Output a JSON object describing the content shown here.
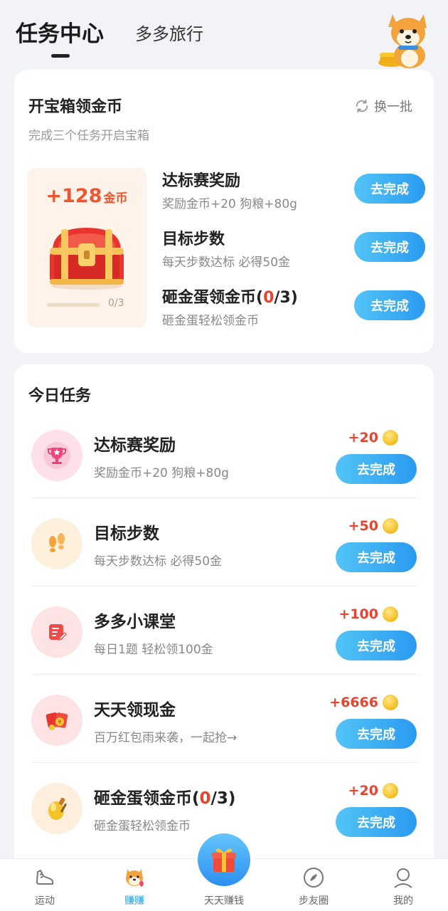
{
  "header": {
    "tab_active": "任务中心",
    "tab_inactive": "多多旅行",
    "mascot_icon": "shiba-dog-mascot"
  },
  "treasure": {
    "title": "开宝箱领金币",
    "subtitle": "完成三个任务开启宝箱",
    "refresh_label": "换一批",
    "amount": "+128",
    "amount_unit": "金币",
    "progress_label": "0/3",
    "progress_fraction": 0,
    "tasks": [
      {
        "title": "达标赛奖励",
        "desc": "奖励金币+20  狗粮+80g",
        "button": "去完成"
      },
      {
        "title": "目标步数",
        "desc": "每天步数达标 必得50金",
        "button": "去完成"
      },
      {
        "title_prefix": "砸金蛋领金币(",
        "title_count": "0",
        "title_suffix": "/3)",
        "desc": "砸金蛋轻松领金币",
        "button": "去完成"
      }
    ]
  },
  "daily": {
    "title": "今日任务",
    "tasks": [
      {
        "title": "达标赛奖励",
        "desc": "奖励金币+20  狗粮+80g",
        "reward": "+20",
        "button": "去完成",
        "icon": "trophy-icon"
      },
      {
        "title": "目标步数",
        "desc": "每天步数达标 必得50金",
        "reward": "+50",
        "button": "去完成",
        "icon": "footprints-icon"
      },
      {
        "title": "多多小课堂",
        "desc": "每日1题  轻松领100金",
        "reward": "+100",
        "button": "去完成",
        "icon": "note-edit-icon"
      },
      {
        "title": "天天领现金",
        "desc": "百万红包雨来袭，一起抢→",
        "reward": "+6666",
        "button": "去完成",
        "icon": "red-envelope-icon"
      },
      {
        "title_prefix": "砸金蛋领金币(",
        "title_count": "0",
        "title_suffix": "/3)",
        "desc": "砸金蛋轻松领金币",
        "reward": "+20",
        "button": "去完成",
        "icon": "golden-egg-icon"
      }
    ]
  },
  "nav": {
    "items": [
      {
        "label": "运动",
        "icon": "sneaker-icon"
      },
      {
        "label": "赚赚",
        "icon": "shiba-icon",
        "active": true
      },
      {
        "label": "天天赚钱",
        "icon": "gift-box-icon"
      },
      {
        "label": "步友圈",
        "icon": "compass-icon"
      },
      {
        "label": "我的",
        "icon": "user-icon"
      }
    ]
  },
  "colors": {
    "accent_blue": "#2a9af0",
    "reward_red": "#e8432f",
    "chest_bg": "#fdf3ea"
  }
}
